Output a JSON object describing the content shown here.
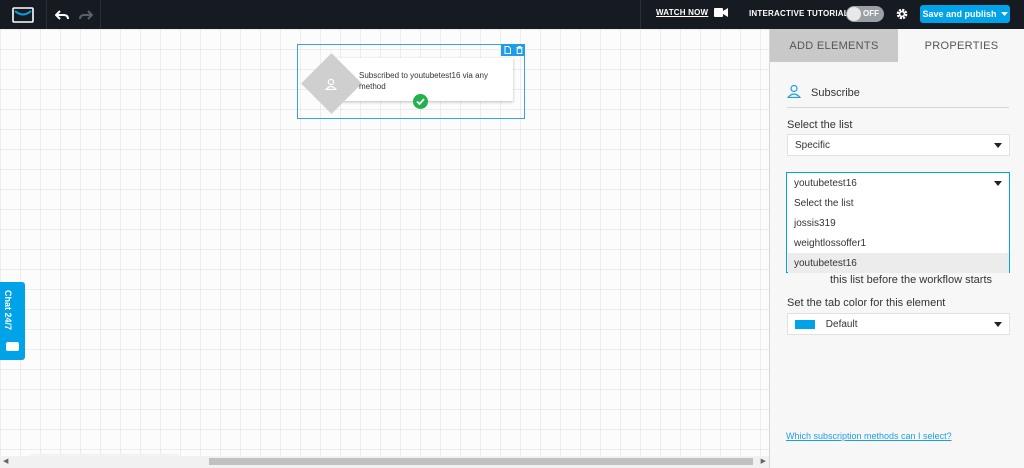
{
  "topbar": {
    "watch_now": "WATCH NOW",
    "interactive_tutorial": "INTERACTIVE TUTORIAL",
    "toggle_state": "OFF",
    "publish_label": "Save and publish"
  },
  "canvas": {
    "node": {
      "text": "Subscribed to youtubetest16 via any method",
      "status": "completed"
    },
    "chat_tab": {
      "label": "Chat 24/7"
    },
    "zoom_level": 0.95
  },
  "panel": {
    "tabs": [
      {
        "label": "ADD ELEMENTS",
        "active": false
      },
      {
        "label": "PROPERTIES",
        "active": true
      }
    ],
    "element_title": "Subscribe",
    "select_list_label": "Select the list",
    "select_list_value": "Specific",
    "list_dropdown": {
      "current": "youtubetest16",
      "options": [
        "Select the list",
        "jossis319",
        "weightlossoffer1",
        "youtubetest16"
      ],
      "highlighted": "youtubetest16"
    },
    "hint_text": "this list before the workflow starts",
    "tab_color_label": "Set the tab color for this element",
    "tab_color_value": "Default",
    "tab_color_hex": "#00a2e8",
    "help_link": "Which subscription methods can I select?"
  },
  "colors": {
    "accent": "#00a2e8",
    "topbar": "#161b22",
    "success": "#21b24c"
  }
}
